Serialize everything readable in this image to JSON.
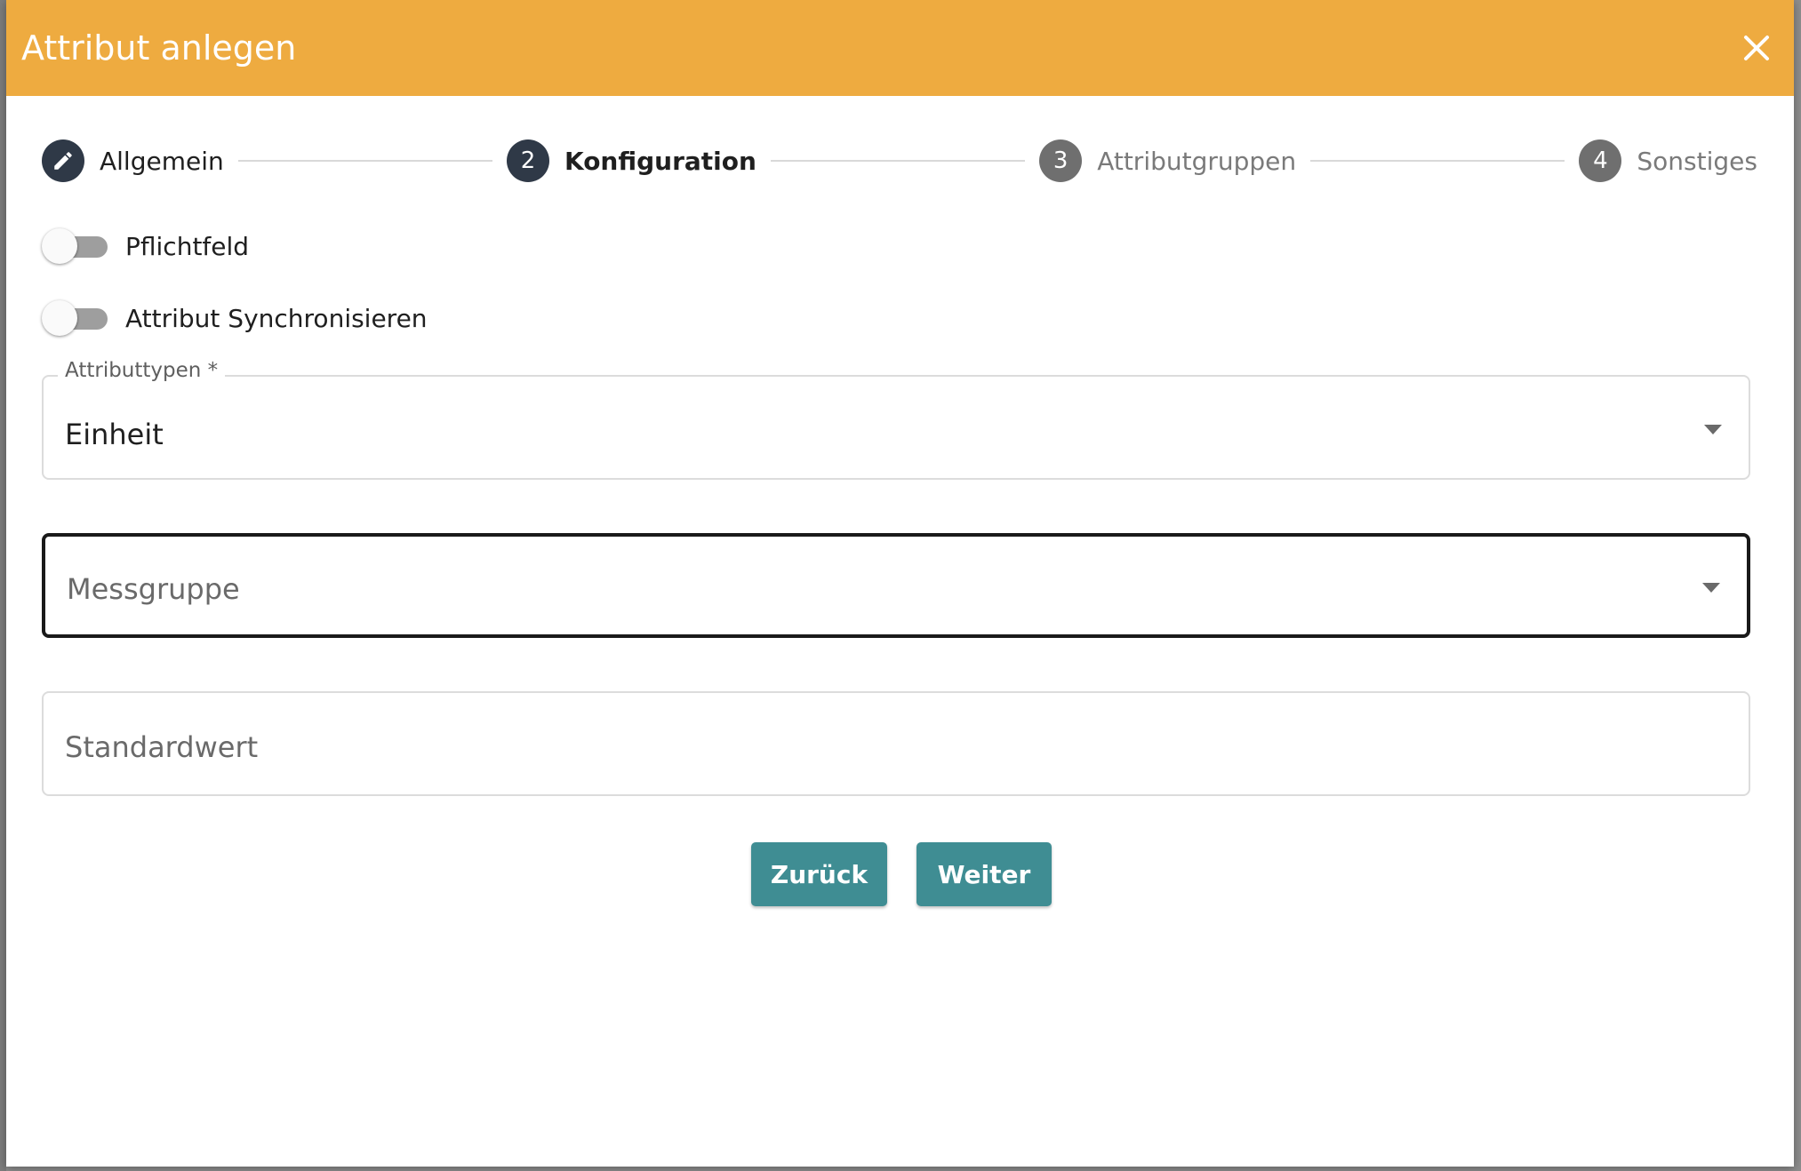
{
  "dialog": {
    "title": "Attribut anlegen",
    "close_icon": "close-icon"
  },
  "stepper": {
    "steps": [
      {
        "number": "",
        "icon": "pencil-icon",
        "label": "Allgemein",
        "state": "done"
      },
      {
        "number": "2",
        "label": "Konfiguration",
        "state": "current"
      },
      {
        "number": "3",
        "label": "Attributgruppen",
        "state": "todo"
      },
      {
        "number": "4",
        "label": "Sonstiges",
        "state": "todo"
      }
    ]
  },
  "toggles": {
    "required": {
      "label": "Pflichtfeld",
      "checked": false
    },
    "sync": {
      "label": "Attribut Synchronisieren",
      "checked": false
    }
  },
  "form": {
    "attribute_type": {
      "label": "Attributtypen *",
      "value": "Einheit"
    },
    "measure_group": {
      "placeholder": "Messgruppe"
    },
    "default_value": {
      "placeholder": "Standardwert"
    }
  },
  "actions": {
    "back_label": "Zurück",
    "next_label": "Weiter"
  },
  "colors": {
    "header": "#eeab40",
    "button": "#3f8d93",
    "step_active": "#2f3947",
    "step_inactive": "#6f6f6f"
  }
}
